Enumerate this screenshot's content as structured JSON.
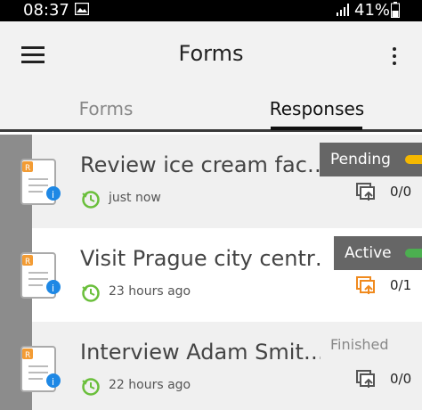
{
  "status_bar": {
    "time": "08:37",
    "battery": "41%"
  },
  "app_bar": {
    "title": "Forms"
  },
  "tabs": [
    {
      "label": "Forms",
      "selected": false
    },
    {
      "label": "Responses",
      "selected": true
    }
  ],
  "colors": {
    "pending_accent": "#f5b800",
    "active_accent": "#4caf50",
    "clock_green": "#6abf3b",
    "sync_orange": "#f08a1e",
    "info_blue": "#1e88e5",
    "doc_orange": "#f39c34"
  },
  "responses": [
    {
      "name": "Review ice cream fac…",
      "time": "just now",
      "status": "Pending",
      "count": "0/0",
      "sync_color": "#555555"
    },
    {
      "name": "Visit Prague city centr…",
      "time": "23 hours ago",
      "status": "Active",
      "count": "0/1",
      "sync_color": "#f08a1e"
    },
    {
      "name": "Interview Adam Smit…",
      "time": "22 hours ago",
      "status": "Finished",
      "count": "0/0",
      "sync_color": "#555555"
    }
  ]
}
